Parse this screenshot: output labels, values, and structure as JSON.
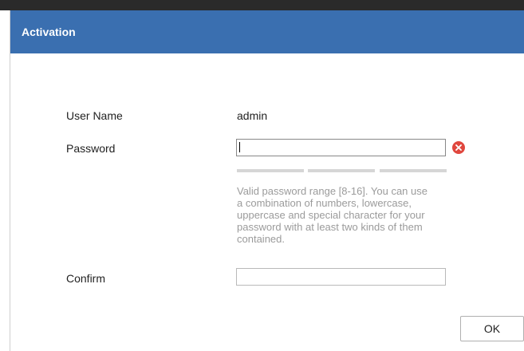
{
  "dialog": {
    "title": "Activation",
    "user_name_label": "User Name",
    "user_name_value": "admin",
    "password_label": "Password",
    "password_value": "",
    "password_hint": "Valid password range [8-16]. You can use a combination of numbers, lowercase, uppercase and special character for your password with at least two kinds of them contained.",
    "confirm_label": "Confirm",
    "confirm_value": "",
    "ok_label": "OK"
  },
  "colors": {
    "header_bg": "#3a6fb0",
    "clear_icon": "#e0473e",
    "strength_bar": "#d6d6d6"
  },
  "icons": {
    "clear": "clear-icon"
  }
}
